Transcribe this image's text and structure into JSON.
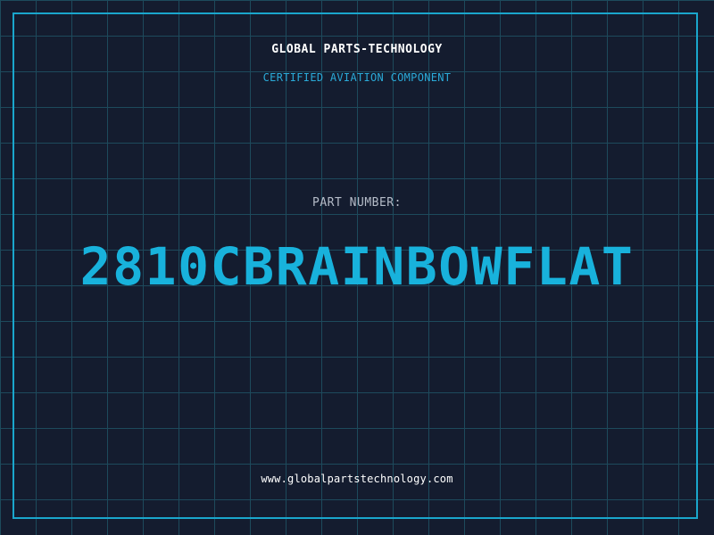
{
  "header": {
    "company_name": "GLOBAL PARTS-TECHNOLOGY",
    "tagline": "CERTIFIED AVIATION COMPONENT"
  },
  "part": {
    "label": "PART NUMBER:",
    "number": "2810CBRAINBOWFLAT"
  },
  "footer": {
    "website": "www.globalpartstechnology.com"
  },
  "colors": {
    "background": "#141c2f",
    "grid": "#1d4a5c",
    "frame": "#1aa6cc",
    "accent": "#18b2dc",
    "label": "#b5bcc8",
    "text": "#ffffff"
  }
}
